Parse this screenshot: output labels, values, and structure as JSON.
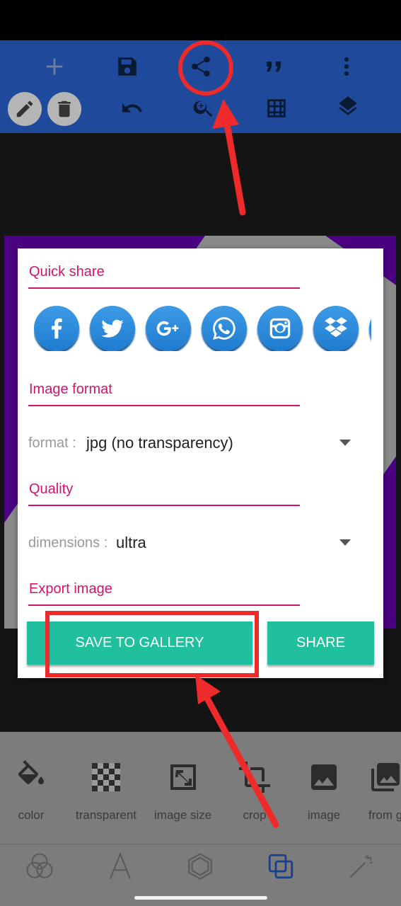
{
  "toolbar": {
    "icons_row1": [
      "plus-icon",
      "save-icon",
      "share-icon",
      "quote-icon",
      "more-vert-icon"
    ],
    "icons_row2": [
      "pencil-icon",
      "trash-icon",
      "undo-icon",
      "zoom-in-icon",
      "grid-icon",
      "layers-icon"
    ]
  },
  "dialog": {
    "quick_share_title": "Quick share",
    "share_targets": [
      "facebook",
      "twitter",
      "google-plus",
      "whatsapp",
      "instagram",
      "dropbox"
    ],
    "image_format_title": "Image format",
    "format_label": "format :",
    "format_value": "jpg (no transparency)",
    "quality_title": "Quality",
    "dimensions_label": "dimensions :",
    "dimensions_value": "ultra",
    "export_title": "Export image",
    "save_button": "SAVE TO GALLERY",
    "share_button": "SHARE"
  },
  "tools": [
    {
      "label": "color",
      "icon": "paint-bucket-icon"
    },
    {
      "label": "transparent",
      "icon": "checkerboard-icon"
    },
    {
      "label": "image size",
      "icon": "resize-icon"
    },
    {
      "label": "crop",
      "icon": "crop-icon"
    },
    {
      "label": "image",
      "icon": "image-icon"
    },
    {
      "label": "from g",
      "icon": "gallery-icon"
    }
  ],
  "nav": [
    "filters-icon",
    "text-icon",
    "shape-icon",
    "overlay-icon",
    "magic-wand-icon"
  ],
  "colors": {
    "toolbar": "#1f4a9c",
    "accent_pink": "#d3136d",
    "button_teal": "#20bf9e",
    "share_blue": "#2a8bde",
    "annotation_red": "#ee2a2a"
  }
}
